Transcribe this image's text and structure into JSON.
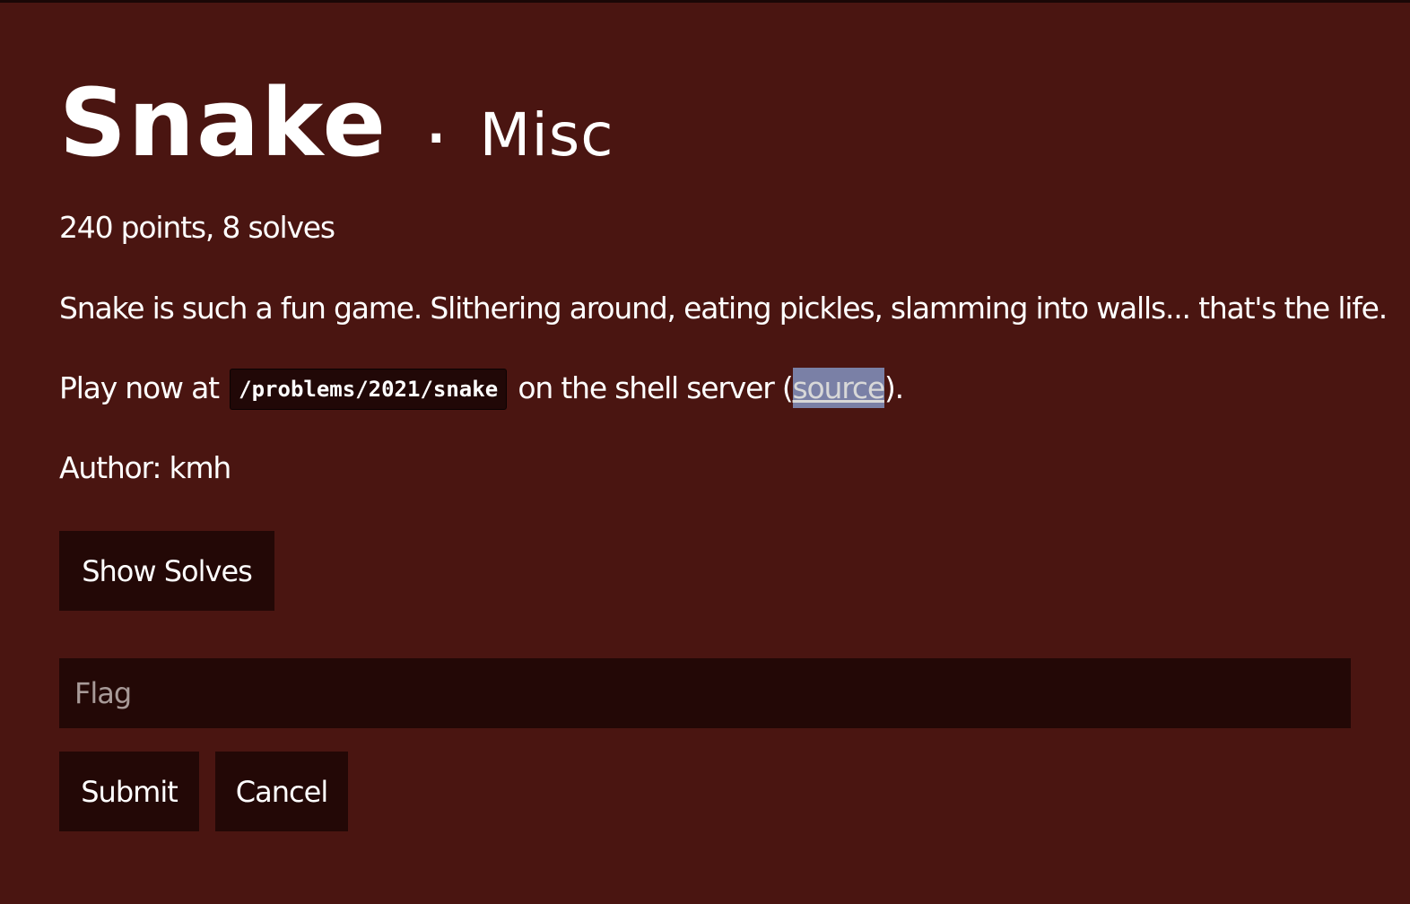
{
  "challenge": {
    "name": "Snake",
    "separator": "·",
    "category": "Misc",
    "stats": "240 points, 8 solves",
    "description_line1": "Snake is such a fun game. Slithering around, eating pickles, slamming into walls... that's the life.",
    "description_line2_prefix": "Play now at ",
    "description_path": "/problems/2021/snake",
    "description_line2_middle": " on the shell server (",
    "source_link_text": "source",
    "description_line2_suffix": ").",
    "author": "Author: kmh"
  },
  "buttons": {
    "show_solves": "Show Solves",
    "submit": "Submit",
    "cancel": "Cancel"
  },
  "flag_input": {
    "placeholder": "Flag",
    "value": ""
  },
  "colors": {
    "background": "#4a1511",
    "button_background": "#230806",
    "selection_highlight": "#7a80a6"
  }
}
